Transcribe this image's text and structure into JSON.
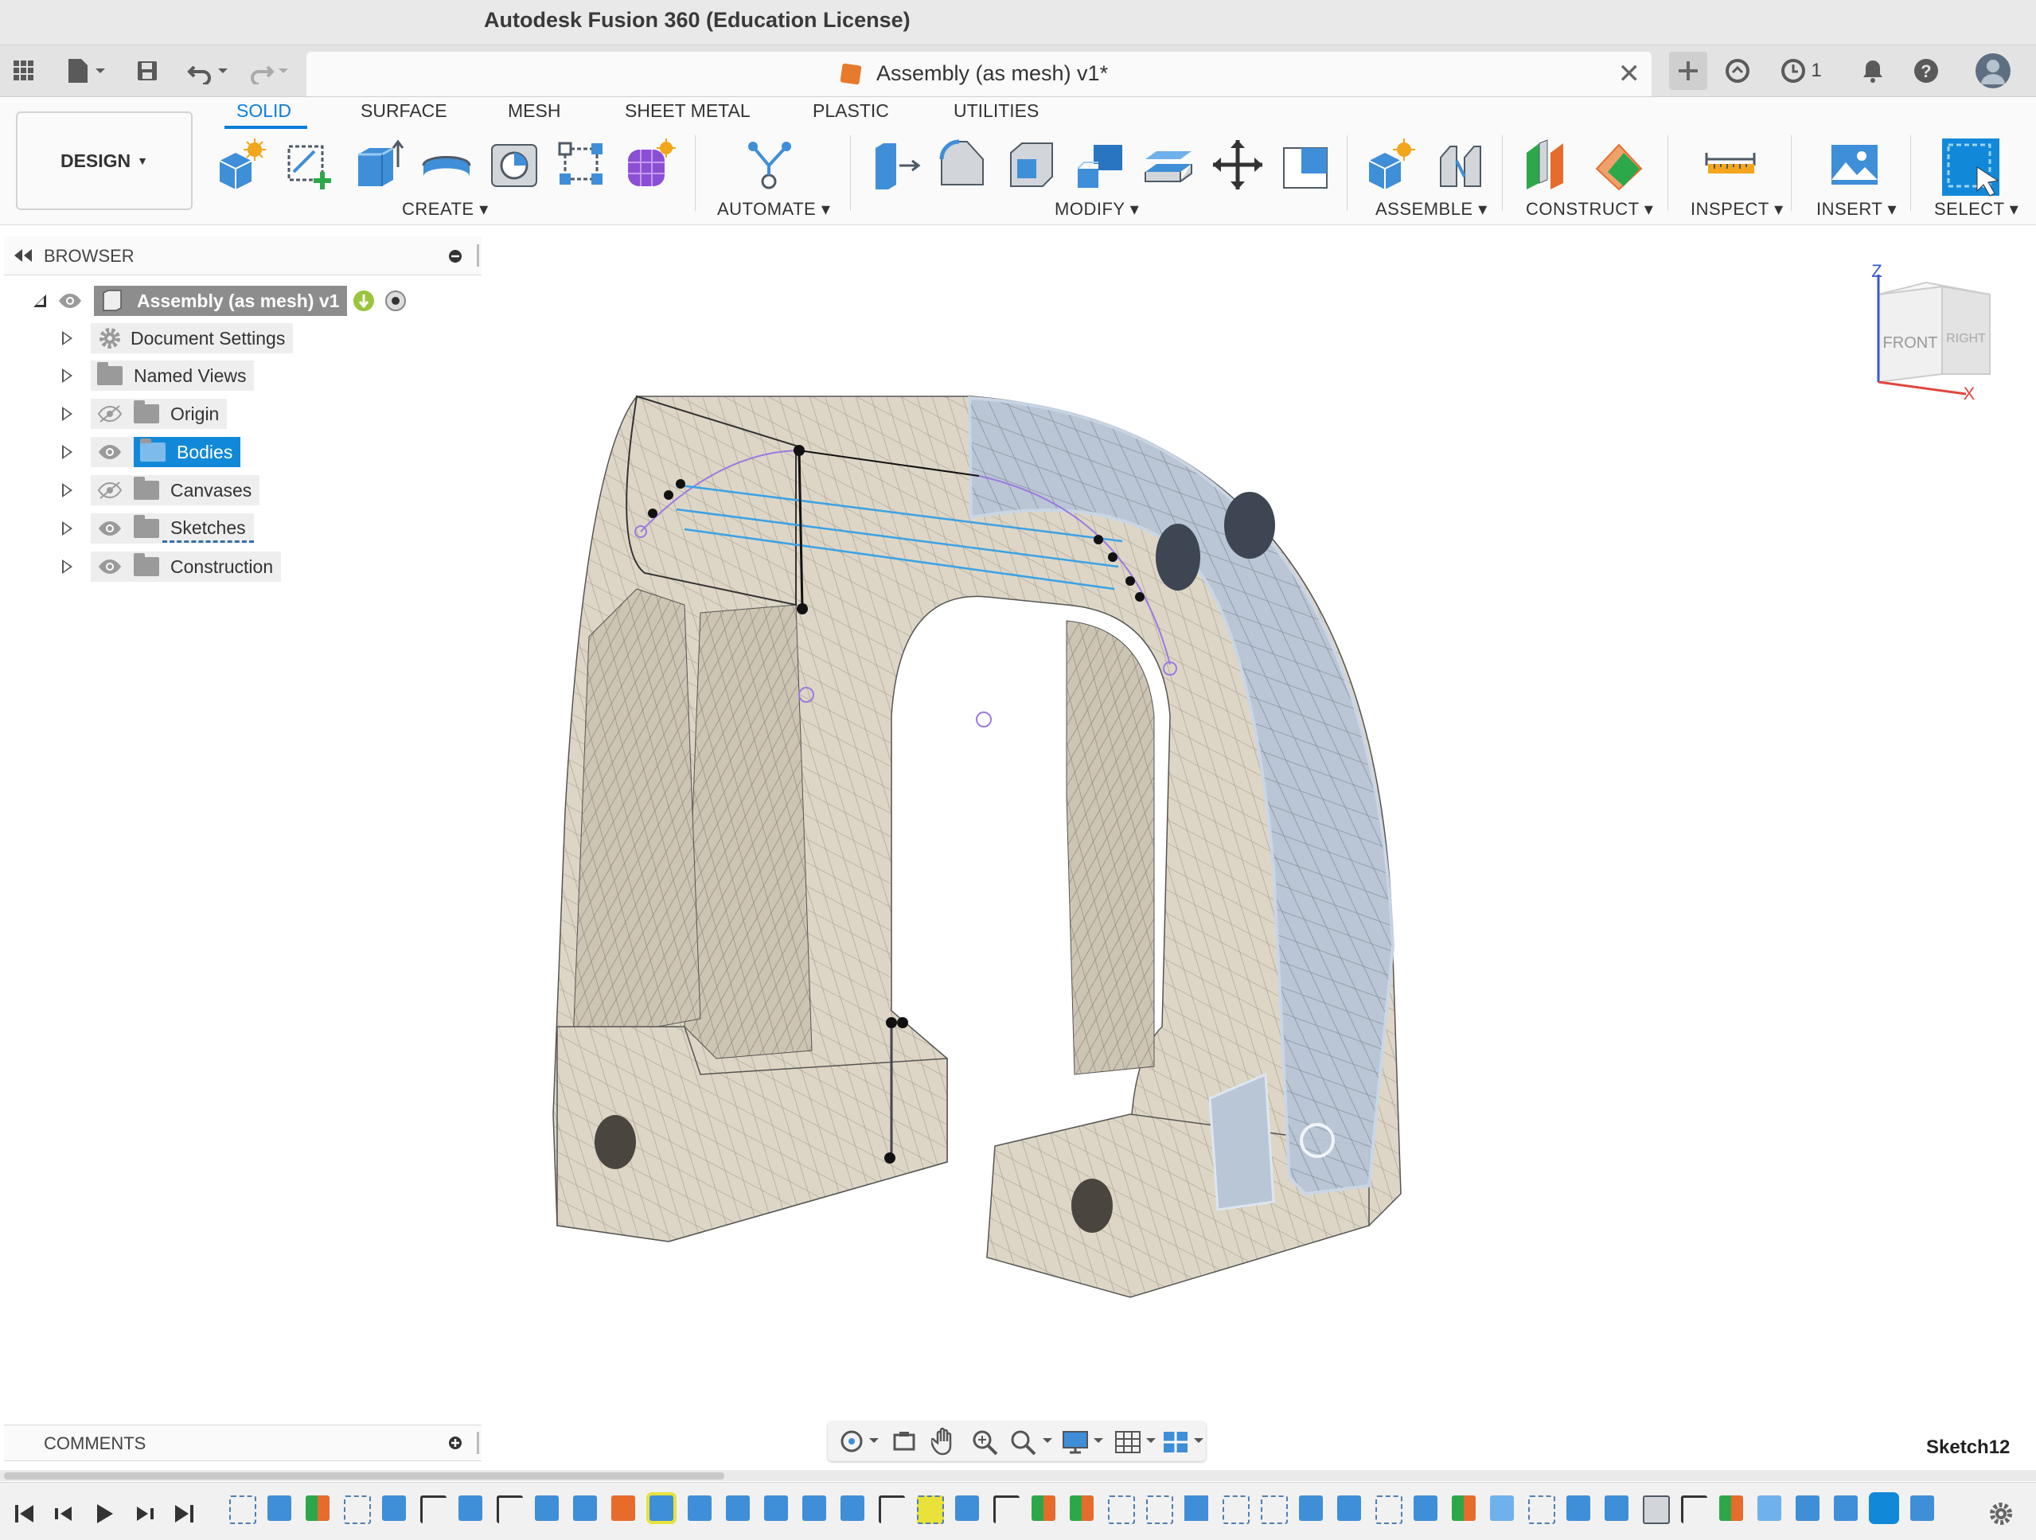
{
  "app": {
    "title": "Autodesk Fusion 360 (Education License)"
  },
  "document": {
    "tab_title": "Assembly (as mesh) v1*",
    "jobs_count": "1"
  },
  "workspace": {
    "label": "DESIGN"
  },
  "toolbar": {
    "tabs": [
      "SOLID",
      "SURFACE",
      "MESH",
      "SHEET METAL",
      "PLASTIC",
      "UTILITIES"
    ],
    "active_tab": "SOLID",
    "groups": {
      "create": "CREATE",
      "automate": "AUTOMATE",
      "modify": "MODIFY",
      "assemble": "ASSEMBLE",
      "construct": "CONSTRUCT",
      "inspect": "INSPECT",
      "insert": "INSERT",
      "select": "SELECT"
    }
  },
  "browser": {
    "title": "BROWSER",
    "root": "Assembly (as mesh) v1",
    "items": [
      {
        "label": "Document Settings"
      },
      {
        "label": "Named Views"
      },
      {
        "label": "Origin",
        "visible": false
      },
      {
        "label": "Bodies",
        "visible": true,
        "selected": true
      },
      {
        "label": "Canvases",
        "visible": false
      },
      {
        "label": "Sketches",
        "visible": true
      },
      {
        "label": "Construction",
        "visible": true
      }
    ]
  },
  "viewcube": {
    "front": "FRONT",
    "right": "RIGHT",
    "axis_z": "Z",
    "axis_x": "X"
  },
  "comments": {
    "title": "COMMENTS"
  },
  "status": {
    "active_sketch": "Sketch12"
  },
  "colors": {
    "accent": "#0a7fd8",
    "mesh_body": "#ddd7c8",
    "selected_body": "#b9c6d6"
  }
}
